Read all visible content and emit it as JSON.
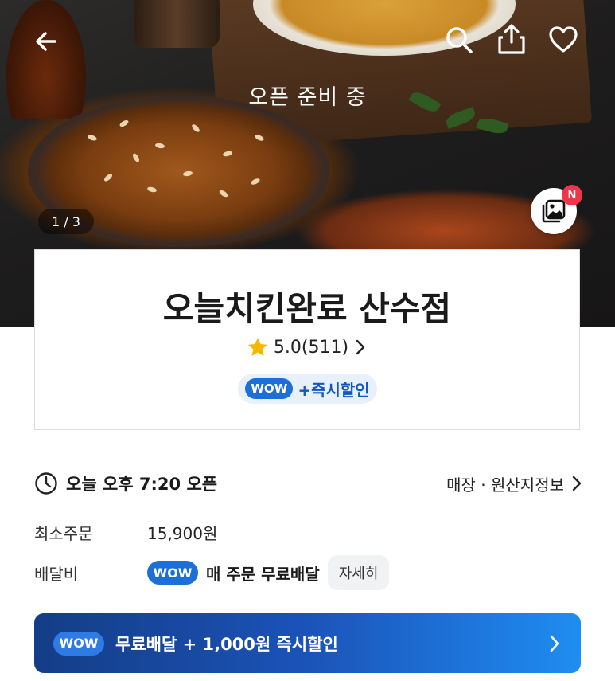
{
  "hero": {
    "status": "오픈 준비 중",
    "image_counter": "1 / 3",
    "gallery_badge": "N"
  },
  "store": {
    "name": "오늘치킨완료 산수점",
    "rating": "5.0",
    "review_count": "(511)",
    "wow_badge": "WOW",
    "wow_promo": "+즉시할인"
  },
  "info": {
    "open_time": "오늘 오후 7:20 오픈",
    "store_info_link": "매장 · 원산지정보",
    "min_order_label": "최소주문",
    "min_order_value": "15,900원",
    "delivery_fee_label": "배달비",
    "delivery_wow_badge": "WOW",
    "delivery_fee_value": "매 주문 무료배달",
    "detail_button": "자세히"
  },
  "banner": {
    "wow_badge": "WOW",
    "text": "무료배달 + 1,000원 즉시할인"
  },
  "icons": {
    "back": "arrow-left-icon",
    "search": "search-icon",
    "share": "share-icon",
    "favorite": "heart-icon",
    "gallery": "image-gallery-icon",
    "star": "star-icon",
    "clock": "clock-icon",
    "chevron": "chevron-right-icon"
  },
  "colors": {
    "wow_blue": "#1d6fd8",
    "star": "#f5b800",
    "badge_red": "#f0344a",
    "banner_start": "#143d86",
    "banner_end": "#1f8df2"
  }
}
